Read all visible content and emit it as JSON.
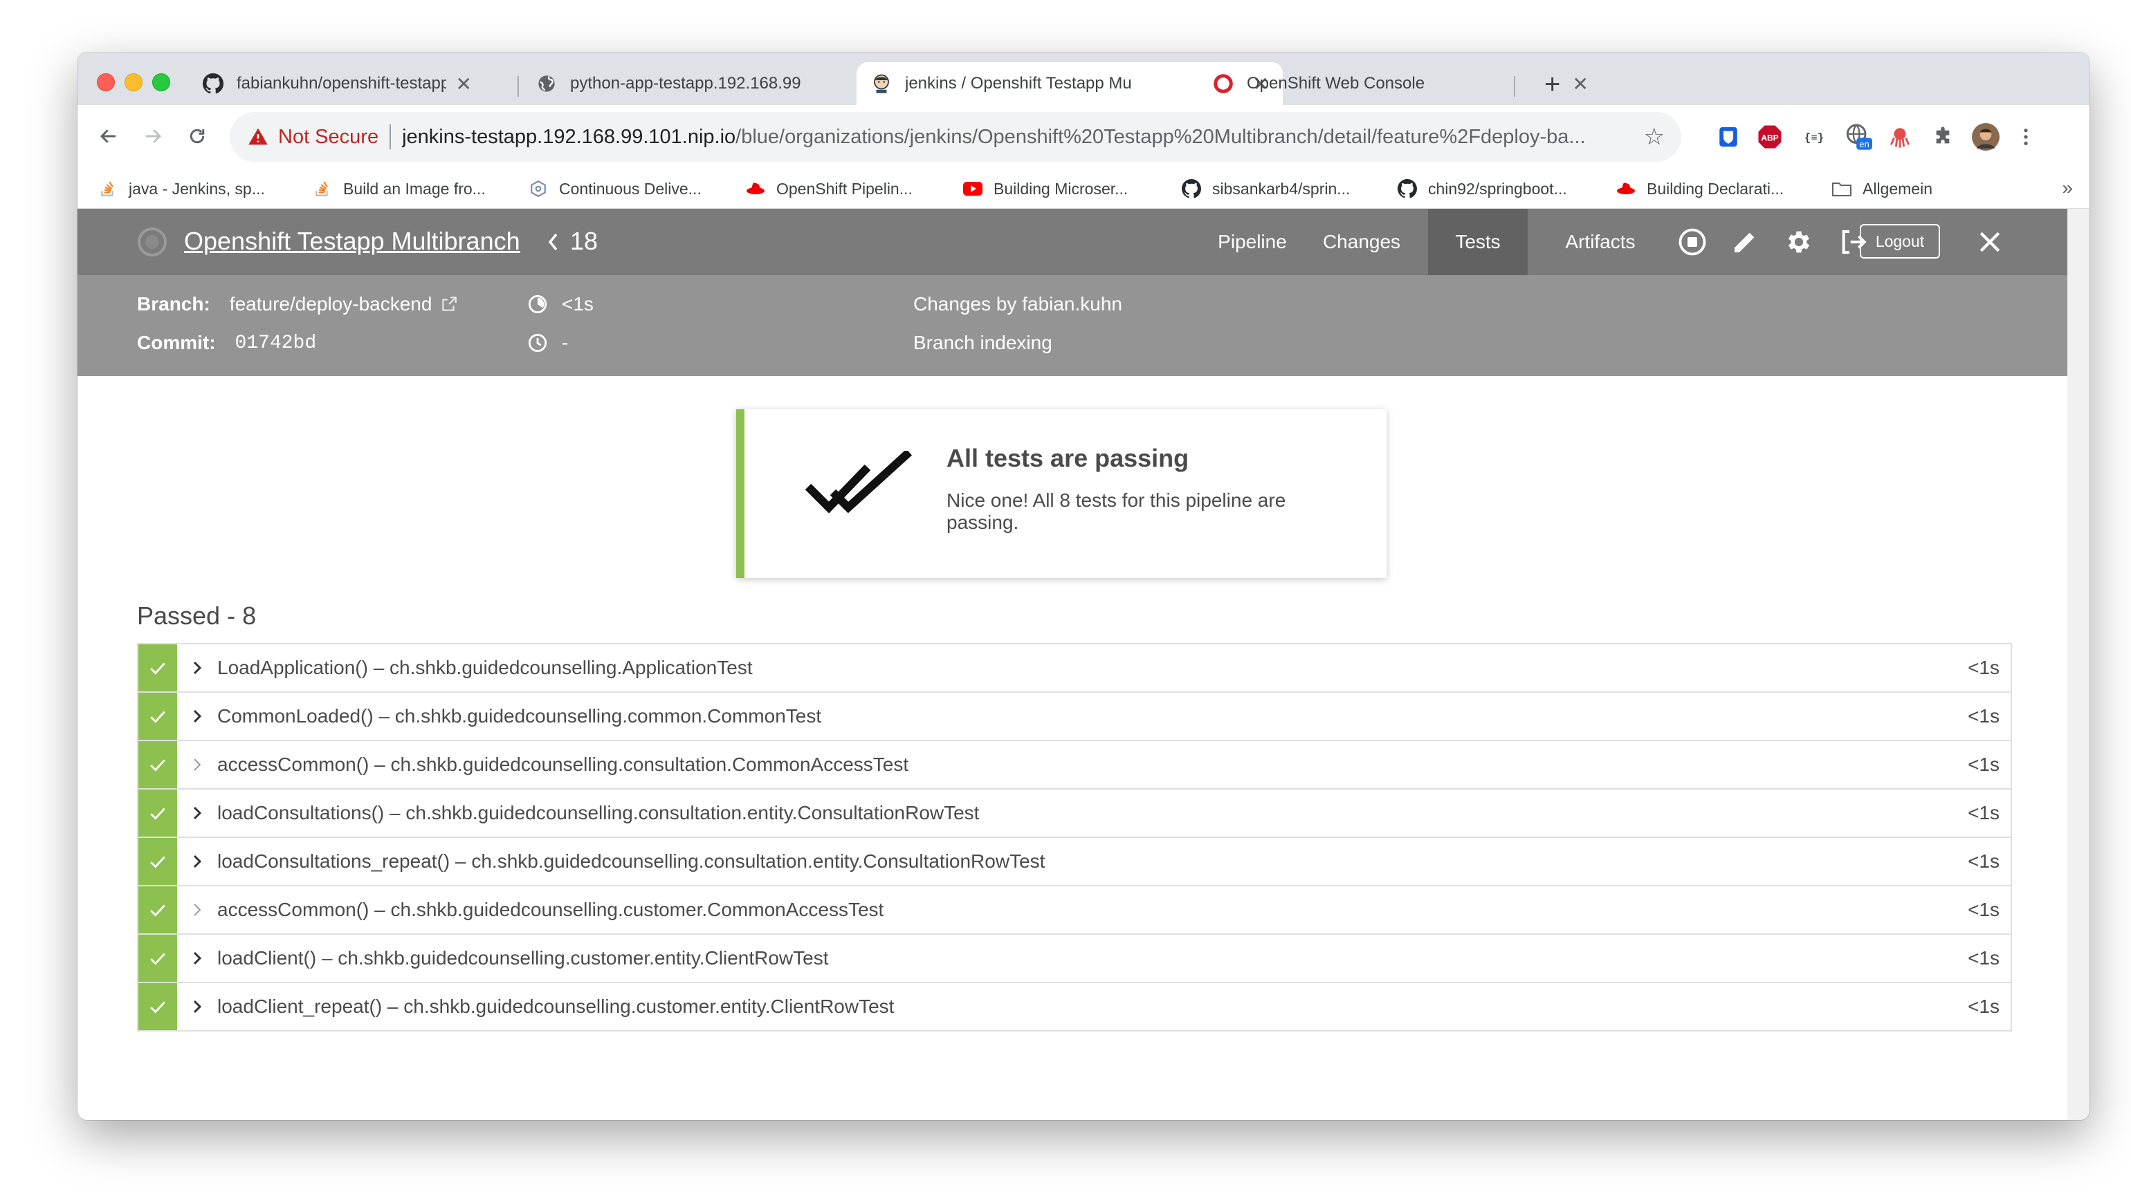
{
  "browser": {
    "tabs": [
      {
        "title": "fabiankuhn/openshift-testapp",
        "favicon": "github-icon"
      },
      {
        "title": "python-app-testapp.192.168.99",
        "favicon": "globe-icon"
      },
      {
        "title": "jenkins / Openshift Testapp Mu",
        "favicon": "jenkins-icon"
      },
      {
        "title": "OpenShift Web Console",
        "favicon": "openshift-icon"
      }
    ],
    "tab_close": "✕",
    "new_tab": "+",
    "security_label": "Not Secure",
    "url_host": "jenkins-testapp.192.168.99.101.nip.io",
    "url_path": "/blue/organizations/jenkins/Openshift%20Testapp%20Multibranch/detail/feature%2Fdeploy-ba...",
    "extension_badge": "en",
    "bookmarks": [
      "java - Jenkins, sp...",
      "Build an Image fro...",
      "Continuous Delive...",
      "OpenShift Pipelin...",
      "Building Microser...",
      "sibsankarb4/sprin...",
      "chin92/springboot...",
      "Building Declarati...",
      "Allgemein"
    ],
    "bookmarks_more": "»"
  },
  "header": {
    "pipeline_name": "Openshift Testapp Multibranch",
    "run_number": "18",
    "nav": [
      "Pipeline",
      "Changes",
      "Tests",
      "Artifacts"
    ],
    "selected_tab": "Tests",
    "logout_label": "Logout"
  },
  "meta": {
    "branch_label": "Branch:",
    "branch_value": "feature/deploy-backend",
    "commit_label": "Commit:",
    "commit_value": "01742bd",
    "duration": "<1s",
    "time": "-",
    "changes": "Changes by fabian.kuhn",
    "cause": "Branch indexing"
  },
  "summary": {
    "title": "All tests are passing",
    "message": "Nice one! All 8 tests for this pipeline are passing.",
    "passed_heading": "Passed - 8"
  },
  "tests": [
    {
      "name": "LoadApplication() – ch.shkb.guidedcounselling.ApplicationTest",
      "duration": "<1s",
      "expandable": true
    },
    {
      "name": "CommonLoaded() – ch.shkb.guidedcounselling.common.CommonTest",
      "duration": "<1s",
      "expandable": true
    },
    {
      "name": "accessCommon() – ch.shkb.guidedcounselling.consultation.CommonAccessTest",
      "duration": "<1s",
      "expandable": false
    },
    {
      "name": "loadConsultations() – ch.shkb.guidedcounselling.consultation.entity.ConsultationRowTest",
      "duration": "<1s",
      "expandable": true
    },
    {
      "name": "loadConsultations_repeat() – ch.shkb.guidedcounselling.consultation.entity.ConsultationRowTest",
      "duration": "<1s",
      "expandable": true
    },
    {
      "name": "accessCommon() – ch.shkb.guidedcounselling.customer.CommonAccessTest",
      "duration": "<1s",
      "expandable": false
    },
    {
      "name": "loadClient() – ch.shkb.guidedcounselling.customer.entity.ClientRowTest",
      "duration": "<1s",
      "expandable": true
    },
    {
      "name": "loadClient_repeat() – ch.shkb.guidedcounselling.customer.entity.ClientRowTest",
      "duration": "<1s",
      "expandable": true
    }
  ],
  "colors": {
    "success": "#8cc04f",
    "header": "#7b7b7b",
    "meta_bar": "#949494",
    "selected_tab": "#626262",
    "not_secure": "#c5221f"
  }
}
